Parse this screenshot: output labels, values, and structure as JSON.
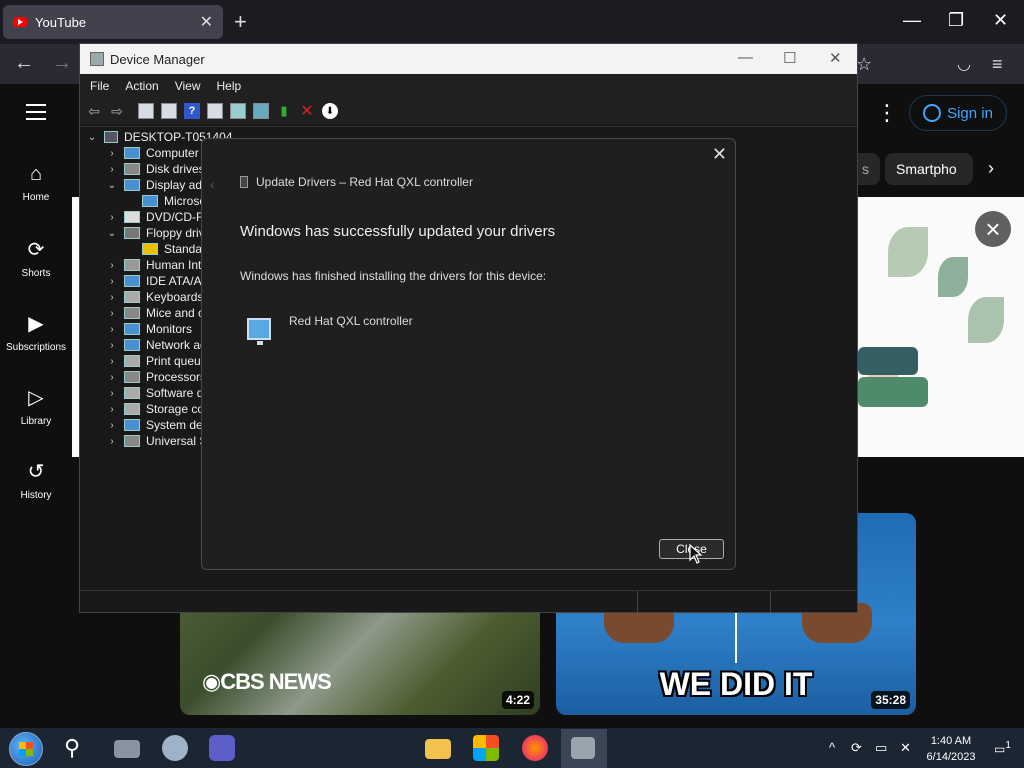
{
  "browser": {
    "tab_title": "YouTube",
    "tab_close": "✕",
    "new_tab": "+",
    "minimize": "—",
    "restore": "❐",
    "close": "✕",
    "back": "←",
    "forward": "→",
    "bookmark_icon": "☆",
    "pocket_icon": "◡",
    "menu_icon": "≡"
  },
  "youtube": {
    "sidebar": [
      {
        "label": "Home",
        "icon": "⌂"
      },
      {
        "label": "Shorts",
        "icon": "⟳"
      },
      {
        "label": "Subscriptions",
        "icon": "▶"
      },
      {
        "label": "Library",
        "icon": "▷"
      },
      {
        "label": "History",
        "icon": "↺"
      }
    ],
    "more_icon": "⋮",
    "sign_in": "Sign in",
    "chips": [
      "s",
      "Smartpho"
    ],
    "chip_next": "›",
    "banner_close": "×",
    "videos": [
      {
        "duration": "4:22",
        "overlay": "◉CBS NEWS"
      },
      {
        "duration": "35:28",
        "overlay": "WE DID IT"
      }
    ]
  },
  "device_manager": {
    "title": "Device Manager",
    "min": "—",
    "max": "☐",
    "close": "✕",
    "menu": [
      "File",
      "Action",
      "View",
      "Help"
    ],
    "root": "DESKTOP-T051404",
    "tree": [
      {
        "label": "Computer",
        "expanded": false,
        "indent": 1
      },
      {
        "label": "Disk drives",
        "expanded": false,
        "indent": 1
      },
      {
        "label": "Display ada",
        "expanded": true,
        "indent": 1
      },
      {
        "label": "Microso",
        "expanded": null,
        "indent": 2
      },
      {
        "label": "DVD/CD-RO",
        "expanded": false,
        "indent": 1
      },
      {
        "label": "Floppy driv",
        "expanded": true,
        "indent": 1
      },
      {
        "label": "Standar",
        "expanded": null,
        "indent": 2
      },
      {
        "label": "Human Inte",
        "expanded": false,
        "indent": 1
      },
      {
        "label": "IDE ATA/ATA",
        "expanded": false,
        "indent": 1
      },
      {
        "label": "Keyboards",
        "expanded": false,
        "indent": 1
      },
      {
        "label": "Mice and ot",
        "expanded": false,
        "indent": 1
      },
      {
        "label": "Monitors",
        "expanded": false,
        "indent": 1
      },
      {
        "label": "Network ad",
        "expanded": false,
        "indent": 1
      },
      {
        "label": "Print queue",
        "expanded": false,
        "indent": 1
      },
      {
        "label": "Processors",
        "expanded": false,
        "indent": 1
      },
      {
        "label": "Software de",
        "expanded": false,
        "indent": 1
      },
      {
        "label": "Storage cor",
        "expanded": false,
        "indent": 1
      },
      {
        "label": "System dev",
        "expanded": false,
        "indent": 1
      },
      {
        "label": "Universal Se",
        "expanded": false,
        "indent": 1
      }
    ]
  },
  "dialog": {
    "close": "✕",
    "back": "‹",
    "header": "Update Drivers – Red Hat QXL controller",
    "heading": "Windows has successfully updated your drivers",
    "message": "Windows has finished installing the drivers for this device:",
    "device": "Red Hat QXL controller",
    "close_button": "Close"
  },
  "taskbar": {
    "time": "1:40 AM",
    "date": "6/14/2023",
    "search_icon": "⚲",
    "tray_arrow": "^",
    "notification_count": "1"
  }
}
